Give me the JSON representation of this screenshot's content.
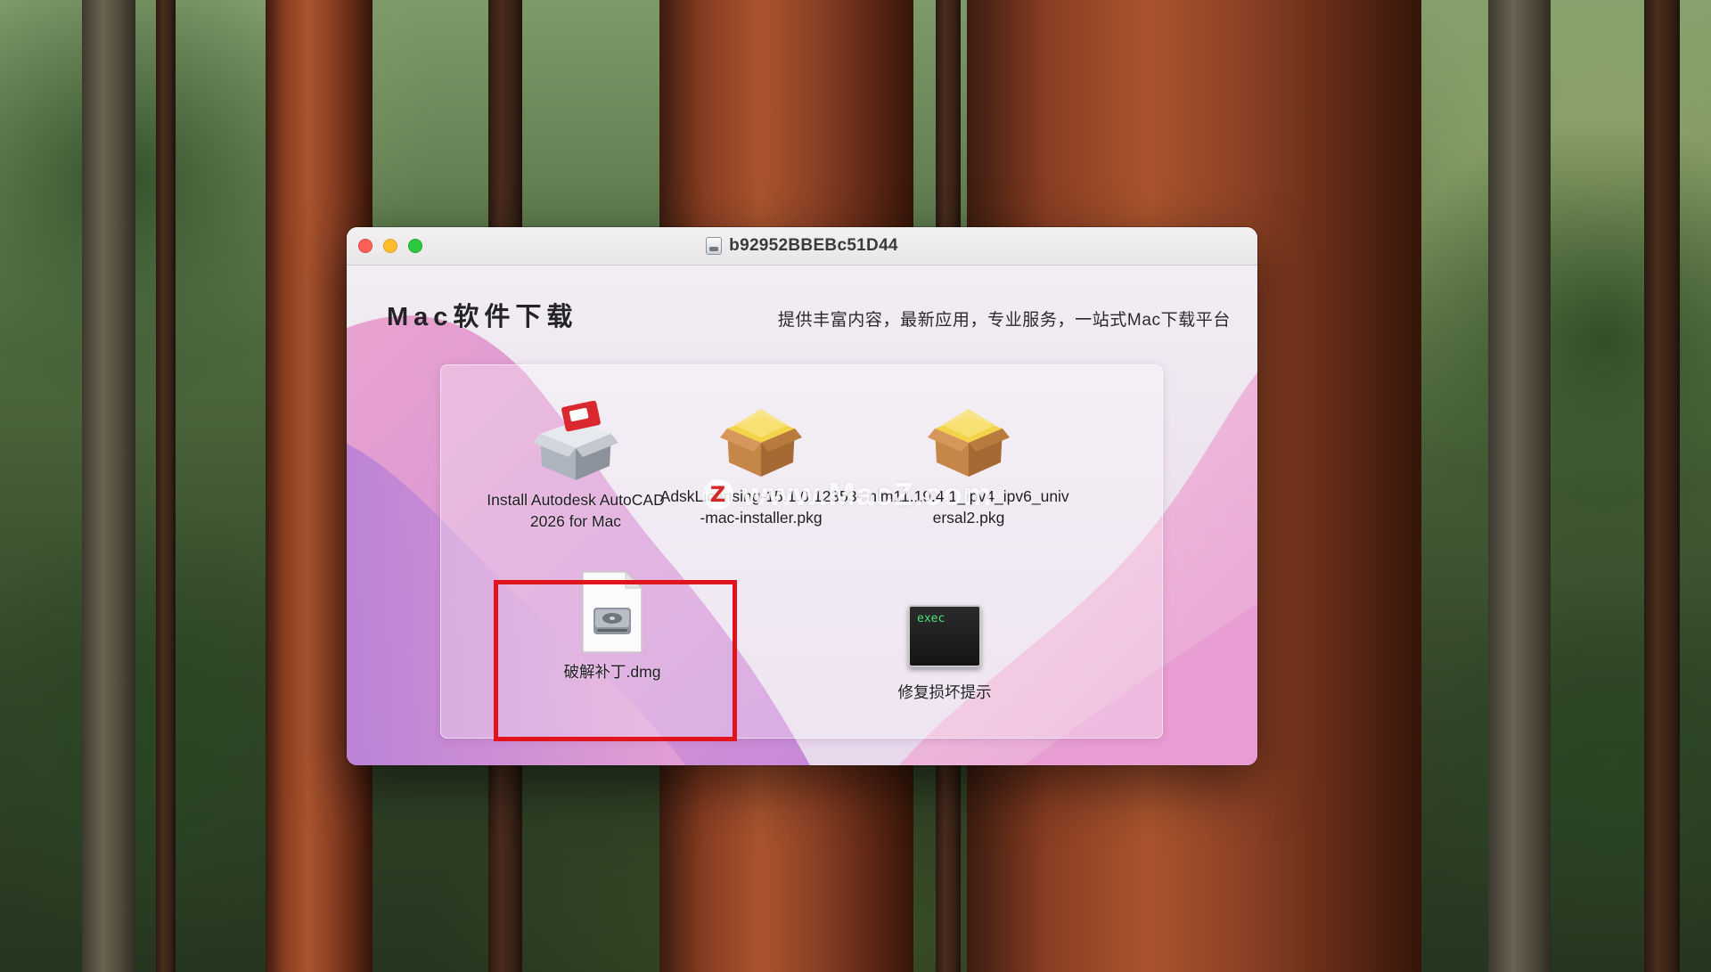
{
  "window": {
    "title": "b92952BBEBc51D44",
    "brand": "Mac软件下载",
    "slogan": "提供丰富内容，最新应用，专业服务，一站式Mac下载平台"
  },
  "items": [
    {
      "label_line1": "Install Autodesk AutoCAD",
      "label_line2": "2026 for Mac",
      "icon": "installer-app-icon"
    },
    {
      "label_line1": "AdskLicensing-15.1.0.12353-",
      "label_line2": "-mac-installer.pkg",
      "icon": "package-icon"
    },
    {
      "label_line1": "nlm11.19.4.1_ipv4_ipv6_univ",
      "label_line2": "ersal2.pkg",
      "icon": "package-icon"
    },
    {
      "label_line1": "破解补丁.dmg",
      "icon": "disk-image-icon"
    },
    {
      "label_line1": "修复损坏提示",
      "icon": "terminal-exec-icon",
      "icon_text": "exec"
    }
  ],
  "watermark": {
    "logo": "Z",
    "text": "www.MacZ.com"
  },
  "colors": {
    "highlight": "#e0141c",
    "close": "#ff5f57",
    "minimize": "#febc2e",
    "maximize": "#28c840",
    "pkg_box": "#b97a3e",
    "pkg_top": "#f3d34a"
  }
}
